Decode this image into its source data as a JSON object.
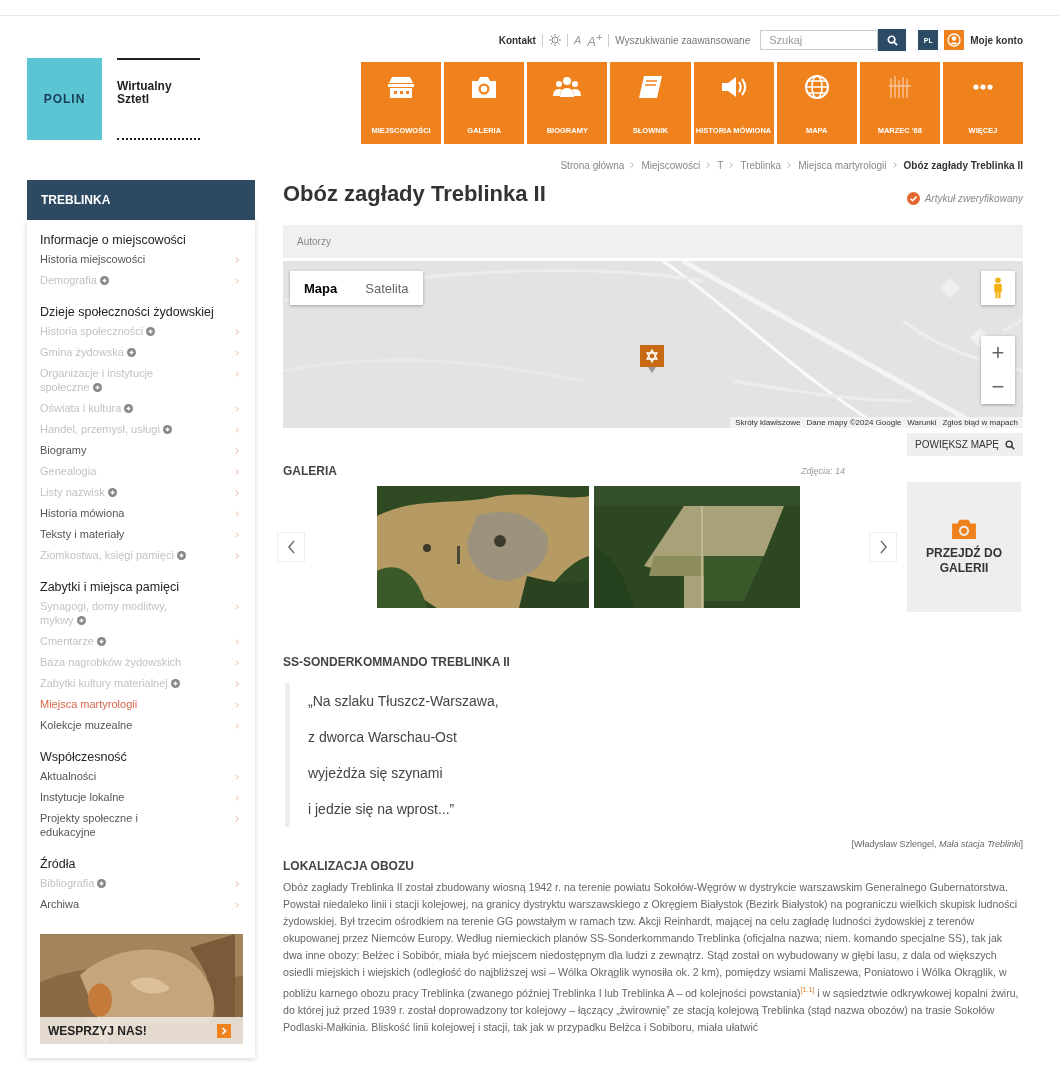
{
  "header": {
    "logo": {
      "brand": "POLIN",
      "title_lines": [
        "Wirtualny",
        "Sztetl"
      ]
    },
    "topbar": {
      "contact": "Kontakt",
      "font_small": "A",
      "font_large": "A$^{+}$",
      "advanced_search": "Wyszukiwanie zaawansowane",
      "search": {
        "placeholder": "Szukaj"
      },
      "language": "PL",
      "account": "Moje konto"
    },
    "nav": [
      {
        "label": "MIEJSCOWOŚCI"
      },
      {
        "label": "GALERIA"
      },
      {
        "label": "BIOGRAMY"
      },
      {
        "label": "SŁOWNIK"
      },
      {
        "label": "HISTORIA MÓWIONA"
      },
      {
        "label": "MAPA"
      },
      {
        "label": "MARZEC '68"
      },
      {
        "label": "WIĘCEJ"
      }
    ]
  },
  "breadcrumb": [
    "Strona główna",
    "Miejscowości",
    "T",
    "Treblinka",
    "Miejsca martyrologii",
    "Obóz zagłady Treblinka II"
  ],
  "sidebar": {
    "title": "TREBLINKA",
    "sections": [
      {
        "heading": "Informacje o miejscowości",
        "items": [
          {
            "label": "Historia miejscowości",
            "disabled": false,
            "selected": false,
            "info": false
          },
          {
            "label": "Demografia",
            "disabled": true,
            "selected": false,
            "info": true
          }
        ]
      },
      {
        "heading": "Dzieje społeczności żydowskiej",
        "items": [
          {
            "label": "Historia społeczności",
            "disabled": true,
            "selected": false,
            "info": true
          },
          {
            "label": "Gmina żydowska",
            "disabled": true,
            "selected": false,
            "info": true
          },
          {
            "label": "Organizacje i instytucje społeczne",
            "disabled": true,
            "selected": false,
            "info": true
          },
          {
            "label": "Oświata i kultura",
            "disabled": true,
            "selected": false,
            "info": true
          },
          {
            "label": "Handel, przemysł, usługi",
            "disabled": true,
            "selected": false,
            "info": true
          },
          {
            "label": "Biogramy",
            "disabled": false,
            "selected": false,
            "info": false
          },
          {
            "label": "Genealogia",
            "disabled": true,
            "selected": false,
            "info": false
          },
          {
            "label": "Listy nazwisk",
            "disabled": true,
            "selected": false,
            "info": true
          },
          {
            "label": "Historia mówiona",
            "disabled": false,
            "selected": false,
            "info": false
          },
          {
            "label": "Teksty i materiały",
            "disabled": false,
            "selected": false,
            "info": false
          },
          {
            "label": "Ziomkostwa, księgi pamięci",
            "disabled": true,
            "selected": false,
            "info": true
          }
        ]
      },
      {
        "heading": "Zabytki i miejsca pamięci",
        "items": [
          {
            "label": "Synagogi, domy modlitwy, mykwy",
            "disabled": true,
            "selected": false,
            "info": true
          },
          {
            "label": "Cmentarze",
            "disabled": true,
            "selected": false,
            "info": true
          },
          {
            "label": "Baza nagrobków żydowskich",
            "disabled": true,
            "selected": false,
            "info": false
          },
          {
            "label": "Zabytki kultury materialnej",
            "disabled": true,
            "selected": false,
            "info": true
          },
          {
            "label": "Miejsca martyrologii",
            "disabled": false,
            "selected": true,
            "info": false
          },
          {
            "label": "Kolekcje muzealne",
            "disabled": false,
            "selected": false,
            "info": false
          }
        ]
      },
      {
        "heading": "Współczesność",
        "items": [
          {
            "label": "Aktualności",
            "disabled": false,
            "selected": false,
            "info": false
          },
          {
            "label": "Instytucje lokalne",
            "disabled": false,
            "selected": false,
            "info": false
          },
          {
            "label": "Projekty społeczne i edukacyjne",
            "disabled": false,
            "selected": false,
            "info": false
          }
        ]
      },
      {
        "heading": "Źródła",
        "items": [
          {
            "label": "Bibliografia",
            "disabled": true,
            "selected": false,
            "info": true
          },
          {
            "label": "Archiwa",
            "disabled": false,
            "selected": false,
            "info": false
          }
        ]
      }
    ],
    "banner": {
      "kind": "picture",
      "label": "WESPRZYJ NAS!"
    }
  },
  "article": {
    "title": "Obóz zagłady Treblinka II",
    "verified": "Artykuł zweryfikowany",
    "authors": "Autorzy",
    "map": {
      "types": [
        {
          "label": "Mapa",
          "selected": true
        },
        {
          "label": "Satelita",
          "selected": false
        }
      ],
      "zoom": [
        "+",
        "−"
      ],
      "attribution": [
        "Skróty klawiszowe",
        "Dane mapy ©2024 Google",
        "Warunki",
        "Zgłoś błąd w mapach"
      ],
      "enlarge": "POWIĘKSZ MAPĘ"
    },
    "gallery": {
      "title": "GALERIA",
      "count": "Zdjęcia: 14",
      "go": "PRZEJDŹ DO GALERII"
    },
    "quote": {
      "heading": "SS-SONDERKOMMANDO TREBLINKA II",
      "lines": [
        "„Na szlaku Tłuszcz-Warszawa,",
        "z dworca Warschau-Ost",
        "wyjeżdża się szynami",
        "i jedzie się na wprost...”"
      ],
      "source": "[Władysław Szlengel, *Mała stacja Treblinki*]"
    },
    "section": {
      "heading": "LOKALIZACJA OBOZU",
      "text": "Obóz zagłady Treblinka II został zbudowany wiosną 1942 r. na terenie powiatu Sokołów-Węgrów w dystrykcie warszawskim Generalnego Gubernatorstwa. Powstał niedaleko linii i stacji kolejowej, na granicy dystryktu warszawskiego z Okręgiem Białystok (Bezirk Białystok) na pograniczu wielkich skupisk ludności żydowskiej. Był trzecim ośrodkiem na terenie GG powstałym w ramach tzw. Akcji Reinhardt, mającej na celu zagładę ludności żydowskiej z terenów okupowanej przez Niemców Europy. Według niemieckich planów SS-Sonderkommando Treblinka (oficjalna nazwa; niem. komando specjalne SS), tak jak dwa inne obozy: Bełżec i Sobibór, miała być miejscem niedostępnym dla ludzi z zewnątrz. Stąd został on wybudowany w głębi lasu, z dala od większych osiedli miejskich i wiejskich (odległość do najbliższej wsi – Wólka Okrąglik wynosiła ok. 2 km), pomiędzy wsiami Maliszewa, Poniatowo i Wólka Okrąglik, w pobliżu karnego obozu pracy Treblinka (zwanego później Treblinka I lub Treblinka A – od kolejności powstania)$^{[1.1]}$ i w sąsiedztwie odkrywkowej kopalni żwiru, do której już przed 1939 r. został doprowadzony tor kolejowy – łączący „żwirownię” ze stacją kolejową Treblinka (stąd nazwa obozów) na trasie Sokołów Podlaski-Małkinia. Bliskość linii kolejowej i stacji, tak jak w przypadku Bełżca i Sobiboru, miała ułatwić"
    }
  }
}
